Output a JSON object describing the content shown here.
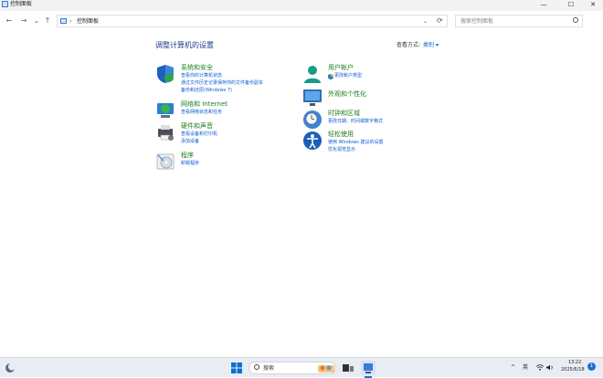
{
  "window": {
    "title": "控制面板",
    "controls": {
      "minimize": "—",
      "maximize": "☐",
      "close": "✕"
    }
  },
  "address": {
    "crumb": "控制面板",
    "crumb_sep": "›",
    "search_placeholder": "搜索控制面板"
  },
  "header": {
    "title": "调整计算机的设置",
    "view_by_label": "查看方式:",
    "view_by_value": "类别 ▾"
  },
  "categories": {
    "system_security": {
      "title": "系统和安全",
      "links": [
        "查看你的计算机状态",
        "通过文件历史记录保存你的文件备份副本",
        "备份和还原(Windows 7)"
      ]
    },
    "network": {
      "title": "网络和 Internet",
      "links": [
        "查看网络状态和任务"
      ]
    },
    "hardware": {
      "title": "硬件和声音",
      "links": [
        "查看设备和打印机",
        "添加设备"
      ]
    },
    "programs": {
      "title": "程序",
      "links": [
        "卸载程序"
      ]
    },
    "user_accounts": {
      "title": "用户帐户",
      "links": [
        "更改帐户类型"
      ]
    },
    "appearance": {
      "title": "外观和个性化",
      "links": []
    },
    "clock_region": {
      "title": "时钟和区域",
      "links": [
        "更改日期、时间或数字格式"
      ]
    },
    "ease_access": {
      "title": "轻松使用",
      "links": [
        "使用 Windows 建议的设置",
        "优化视觉显示"
      ]
    }
  },
  "taskbar": {
    "search_label": "搜索",
    "ime": "英",
    "time": "13:22",
    "date": "2025/6/18",
    "notifications": "1"
  }
}
